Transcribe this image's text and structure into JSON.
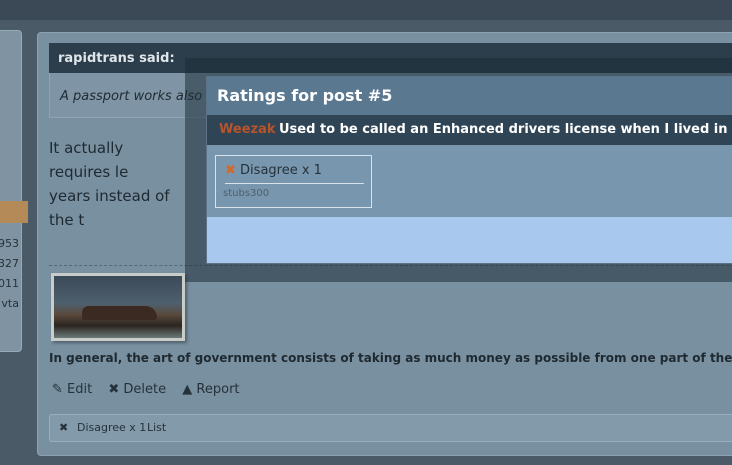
{
  "sidebar": {
    "stats": [
      "953",
      "327",
      "011",
      "vta"
    ]
  },
  "post": {
    "quote_author": "rapidtrans said:",
    "quote_text": "A passport works also",
    "body_line1": "It actually requires le",
    "body_line2": "years instead of the t",
    "signature": "In general, the art of government consists of taking as much money as possible from one part of the citi",
    "actions": {
      "edit": "Edit",
      "delete": "Delete",
      "report": "Report"
    },
    "ratings_bar": {
      "label": "Disagree x 1",
      "list": "List"
    }
  },
  "modal": {
    "title": "Ratings for post #5",
    "author": "Weezak",
    "quote": "Used to be called an Enhanced drivers license when I lived in",
    "rating": {
      "label": "Disagree",
      "count": "x 1",
      "user": "stubs300"
    }
  },
  "icons": {
    "disagree": "x-icon",
    "edit": "pencil-icon",
    "delete": "x-icon",
    "report": "warning-icon"
  },
  "colors": {
    "accent": "#d16a2a",
    "modal_header": "#5b7891",
    "modal_sub": "#2f4556"
  }
}
